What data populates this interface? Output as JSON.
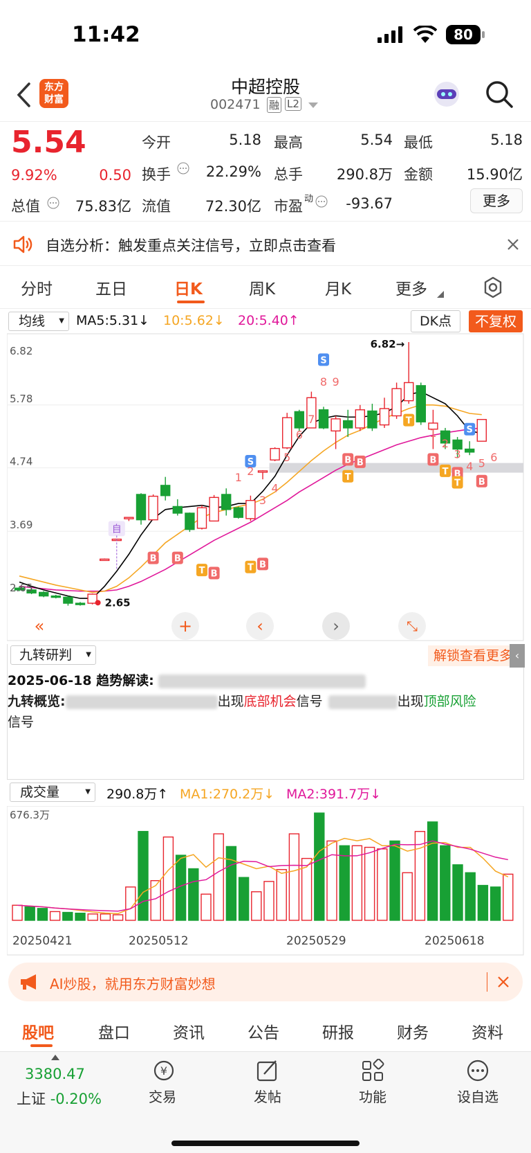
{
  "status": {
    "time": "11:42",
    "battery": "80"
  },
  "header": {
    "stock_name": "中超控股",
    "stock_code": "002471",
    "tag_rong": "融",
    "tag_l2": "L2",
    "logo_line1": "东方",
    "logo_line2": "财富"
  },
  "quote": {
    "price": "5.54",
    "pct": "9.92%",
    "change": "0.50",
    "open_label": "今开",
    "open": "5.18",
    "high_label": "最高",
    "high": "5.54",
    "low_label": "最低",
    "low": "5.18",
    "turnover_label": "换手",
    "turnover": "22.29%",
    "volume_label": "总手",
    "volume": "290.8万",
    "amount_label": "金额",
    "amount": "15.90亿",
    "mktcap_label": "总值",
    "mktcap": "75.83亿",
    "float_label": "流值",
    "float": "72.30亿",
    "pe_label": "市盈",
    "pe_sup": "动",
    "pe": "-93.67",
    "more": "更多"
  },
  "alert": {
    "text": "自选分析：触发重点关注信号，立即点击查看"
  },
  "tabs": [
    "分时",
    "五日",
    "日K",
    "周K",
    "月K",
    "更多"
  ],
  "ma": {
    "select": "均线",
    "ma5": "MA5:5.31↓",
    "ma10": "10:5.62↓",
    "ma20": "20:5.40↑",
    "dk": "DK点",
    "fq": "不复权"
  },
  "chart_data": {
    "type": "candlestick",
    "y_ticks": [
      "6.82",
      "5.78",
      "4.74",
      "3.69",
      "2.65"
    ],
    "ylim": [
      2.65,
      6.82
    ],
    "max_label": "6.82→",
    "min_label": "2.65",
    "x_ticks": [
      "20250421",
      "20250512",
      "20250529",
      "20250618"
    ],
    "candles": [
      {
        "o": 2.75,
        "c": 2.72,
        "h": 2.78,
        "l": 2.7
      },
      {
        "o": 2.72,
        "c": 2.67,
        "h": 2.75,
        "l": 2.65
      },
      {
        "o": 2.68,
        "c": 2.62,
        "h": 2.7,
        "l": 2.6
      },
      {
        "o": 2.62,
        "c": 2.6,
        "h": 2.64,
        "l": 2.58
      },
      {
        "o": 2.6,
        "c": 2.5,
        "h": 2.62,
        "l": 2.46
      },
      {
        "o": 2.5,
        "c": 2.48,
        "h": 2.52,
        "l": 2.46
      },
      {
        "o": 2.5,
        "c": 2.65,
        "h": 2.66,
        "l": 2.48
      },
      {
        "o": 3.22,
        "c": 3.23,
        "h": 3.24,
        "l": 3.22
      },
      {
        "o": 3.55,
        "c": 3.56,
        "h": 3.56,
        "l": 3.55
      },
      {
        "o": 3.91,
        "c": 3.92,
        "h": 3.92,
        "l": 3.86
      },
      {
        "o": 4.3,
        "c": 3.88,
        "h": 4.32,
        "l": 3.8
      },
      {
        "o": 3.88,
        "c": 4.27,
        "h": 4.3,
        "l": 3.88
      },
      {
        "o": 4.45,
        "c": 4.28,
        "h": 4.59,
        "l": 4.2
      },
      {
        "o": 4.1,
        "c": 3.99,
        "h": 4.22,
        "l": 3.95
      },
      {
        "o": 3.99,
        "c": 3.72,
        "h": 4.0,
        "l": 3.68
      },
      {
        "o": 3.74,
        "c": 4.08,
        "h": 4.12,
        "l": 3.72
      },
      {
        "o": 3.86,
        "c": 4.25,
        "h": 4.29,
        "l": 3.86
      },
      {
        "o": 4.3,
        "c": 4.05,
        "h": 4.4,
        "l": 3.95
      },
      {
        "o": 4.08,
        "c": 3.92,
        "h": 4.1,
        "l": 3.9
      },
      {
        "o": 3.9,
        "c": 4.2,
        "h": 4.28,
        "l": 3.86
      },
      {
        "o": 4.68,
        "c": 4.69,
        "h": 4.7,
        "l": 4.55
      },
      {
        "o": 4.87,
        "c": 5.06,
        "h": 5.08,
        "l": 4.85
      },
      {
        "o": 5.07,
        "c": 5.57,
        "h": 5.65,
        "l": 5.05
      },
      {
        "o": 5.67,
        "c": 5.4,
        "h": 5.7,
        "l": 5.35
      },
      {
        "o": 5.4,
        "c": 5.9,
        "h": 6.0,
        "l": 5.4
      },
      {
        "o": 5.7,
        "c": 5.4,
        "h": 5.75,
        "l": 5.38
      },
      {
        "o": 5.35,
        "c": 5.55,
        "h": 5.6,
        "l": 5.05
      },
      {
        "o": 5.52,
        "c": 5.4,
        "h": 5.7,
        "l": 5.25
      },
      {
        "o": 5.4,
        "c": 5.7,
        "h": 5.78,
        "l": 5.35
      },
      {
        "o": 5.68,
        "c": 5.4,
        "h": 5.8,
        "l": 5.35
      },
      {
        "o": 5.45,
        "c": 5.72,
        "h": 5.9,
        "l": 5.4
      },
      {
        "o": 5.6,
        "c": 6.05,
        "h": 6.15,
        "l": 5.55
      },
      {
        "o": 5.85,
        "c": 6.15,
        "h": 6.82,
        "l": 5.8
      },
      {
        "o": 6.1,
        "c": 5.5,
        "h": 6.15,
        "l": 5.45
      },
      {
        "o": 5.38,
        "c": 5.48,
        "h": 5.7,
        "l": 5.05
      },
      {
        "o": 5.35,
        "c": 5.15,
        "h": 5.4,
        "l": 5.05
      },
      {
        "o": 5.2,
        "c": 5.05,
        "h": 5.25,
        "l": 4.9
      },
      {
        "o": 5.05,
        "c": 5.0,
        "h": 5.18,
        "l": 4.95
      },
      {
        "o": 5.18,
        "c": 5.54,
        "h": 5.54,
        "l": 5.18
      }
    ],
    "ma5": [
      2.85,
      2.78,
      2.72,
      2.67,
      2.62,
      2.58,
      2.58,
      2.78,
      3.03,
      3.31,
      3.63,
      3.9,
      4.05,
      4.08,
      4.1,
      4.12,
      4.08,
      4.1,
      4.15,
      4.15,
      4.35,
      4.6,
      4.95,
      5.26,
      5.48,
      5.56,
      5.6,
      5.58,
      5.58,
      5.6,
      5.65,
      5.75,
      5.95,
      6.0,
      5.9,
      5.8,
      5.6,
      5.35,
      5.31
    ],
    "ma10": [
      2.95,
      2.9,
      2.85,
      2.8,
      2.76,
      2.72,
      2.68,
      2.7,
      2.78,
      2.92,
      3.1,
      3.3,
      3.5,
      3.64,
      3.78,
      3.92,
      4.0,
      4.05,
      4.1,
      4.14,
      4.22,
      4.34,
      4.5,
      4.68,
      4.86,
      5.02,
      5.16,
      5.28,
      5.36,
      5.46,
      5.56,
      5.64,
      5.72,
      5.78,
      5.78,
      5.76,
      5.7,
      5.64,
      5.62
    ],
    "ma20": [
      2.78,
      2.76,
      2.74,
      2.72,
      2.71,
      2.7,
      2.7,
      2.7,
      2.72,
      2.78,
      2.86,
      2.96,
      3.06,
      3.18,
      3.3,
      3.42,
      3.54,
      3.64,
      3.74,
      3.84,
      3.96,
      4.08,
      4.2,
      4.34,
      4.46,
      4.58,
      4.7,
      4.8,
      4.88,
      4.96,
      5.04,
      5.12,
      5.18,
      5.24,
      5.28,
      5.32,
      5.35,
      5.38,
      5.4
    ],
    "nine_up": [
      "1",
      "2",
      "3",
      "4",
      "5",
      "6",
      "7",
      "8",
      "9"
    ],
    "nine_down": [
      "1",
      "2",
      "3",
      "4",
      "5",
      "6"
    ],
    "signals": {
      "buy": "B",
      "sell": "S",
      "trend": "T",
      "self": "自"
    }
  },
  "nine": {
    "select": "九转研判",
    "unlock": "解锁查看更多",
    "date_line": "2025-06-18 趋势解读:",
    "overview_label": "九转概览:",
    "appear": "出现",
    "bottom_signal": "底部机会",
    "signal": "信号",
    "top_risk": "顶部风险",
    "signal2": "信号"
  },
  "volume": {
    "select": "成交量",
    "current": "290.8万↑",
    "ma1": "MA1:270.2万↓",
    "ma2": "MA2:391.7万↓",
    "max": "676.3万",
    "values": [
      95,
      85,
      75,
      55,
      50,
      45,
      40,
      40,
      35,
      210,
      560,
      250,
      525,
      410,
      325,
      165,
      545,
      465,
      270,
      180,
      245,
      320,
      545,
      390,
      676,
      500,
      470,
      470,
      460,
      450,
      500,
      300,
      560,
      620,
      470,
      350,
      300,
      220,
      210,
      290.8
    ],
    "up": [
      true,
      false,
      false,
      true,
      false,
      false,
      true,
      true,
      true,
      true,
      false,
      true,
      true,
      false,
      false,
      true,
      true,
      false,
      false,
      true,
      true,
      true,
      true,
      true,
      false,
      true,
      false,
      true,
      true,
      true,
      false,
      true,
      true,
      false,
      false,
      false,
      false,
      false,
      false,
      true
    ]
  },
  "ai": {
    "text": "AI炒股，就用东方财富妙想"
  },
  "subtabs": [
    "股吧",
    "盘口",
    "资讯",
    "公告",
    "研报",
    "财务",
    "资料"
  ],
  "bottom": {
    "index_value": "3380.47",
    "index_label": "上证",
    "index_change": "-0.20%",
    "trade": "交易",
    "post": "发帖",
    "func": "功能",
    "watch": "设自选"
  },
  "colors": {
    "up": "#e8242e",
    "down": "#18a034",
    "accent": "#ff5a00",
    "ma5": "#000000",
    "ma10": "#f5a623",
    "ma20": "#e0189a"
  }
}
